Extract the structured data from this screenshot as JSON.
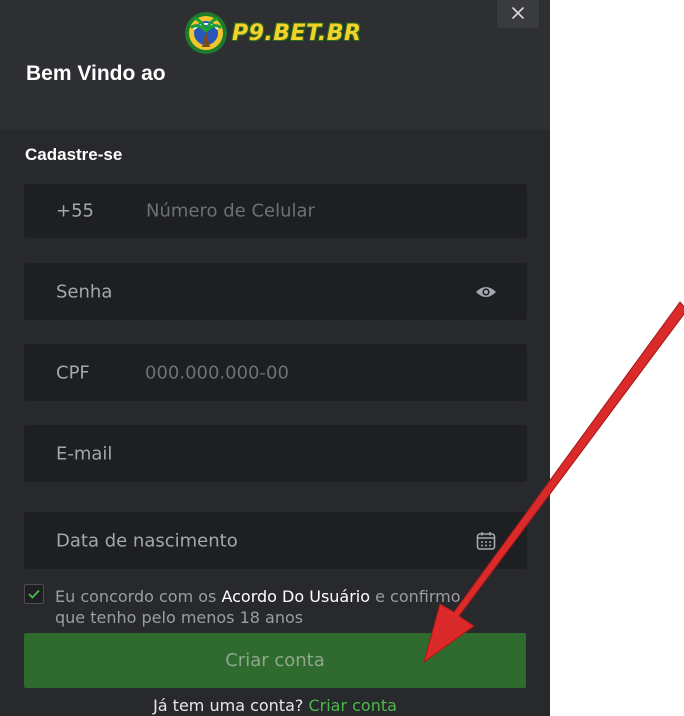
{
  "brand": {
    "logo_text": "P9.BET.BR"
  },
  "header": {
    "welcome": "Bem Vindo ao",
    "close_icon": "close-icon"
  },
  "form": {
    "title": "Cadastre-se",
    "phone": {
      "prefix": "+55",
      "placeholder": "Número de Celular"
    },
    "password": {
      "placeholder": "Senha",
      "icon": "eye-icon"
    },
    "cpf": {
      "label": "CPF",
      "placeholder": "000.000.000-00"
    },
    "email": {
      "placeholder": "E-mail"
    },
    "birthdate": {
      "placeholder": "Data de nascimento",
      "icon": "calendar-icon"
    },
    "agreement": {
      "checked": true,
      "text_before": "Eu concordo com os ",
      "link": "Acordo Do Usuário",
      "text_after": " e confirmo que tenho pelo menos 18 anos"
    },
    "submit_label": "Criar conta"
  },
  "footer": {
    "question": "Já tem uma conta? ",
    "link": "Criar conta"
  },
  "colors": {
    "panel": "#28292c",
    "field": "#1e1f22",
    "button": "#2f6a2e",
    "accent": "#4cb84a",
    "arrow": "#e02a2a"
  }
}
